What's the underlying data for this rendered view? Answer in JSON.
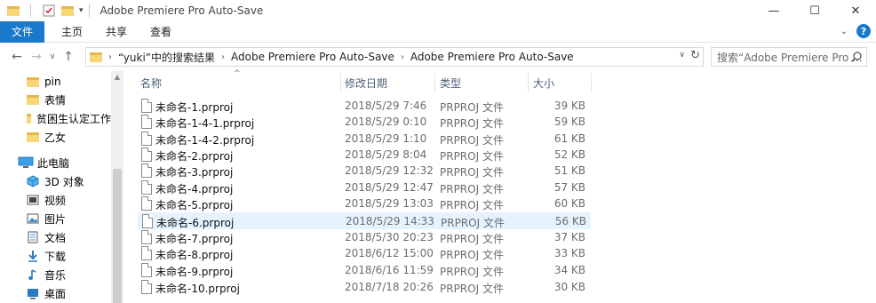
{
  "window": {
    "title": "Adobe Premiere Pro Auto-Save",
    "controls": {
      "minimize": "—",
      "maximize": "☐",
      "close": "✕"
    }
  },
  "ribbon": {
    "file_tab": "文件",
    "tabs": [
      "主页",
      "共享",
      "查看"
    ],
    "help": "?"
  },
  "address": {
    "crumbs": [
      "“yuki”中的搜索结果",
      "Adobe Premiere Pro Auto-Save",
      "Adobe Premiere Pro Auto-Save"
    ],
    "search_placeholder": "搜索“Adobe Premiere Pro ..."
  },
  "nav": {
    "folders": [
      "pin",
      "表情",
      "贫困生认定工作",
      "乙女"
    ],
    "this_pc": "此电脑",
    "pc_items": [
      "3D 对象",
      "视频",
      "图片",
      "文档",
      "下载",
      "音乐",
      "桌面"
    ]
  },
  "columns": {
    "name": "名称",
    "date": "修改日期",
    "type": "类型",
    "size": "大小"
  },
  "files": [
    {
      "name": "未命名-1.prproj",
      "date": "2018/5/29 7:46",
      "type": "PRPROJ 文件",
      "size": "39 KB"
    },
    {
      "name": "未命名-1-4-1.prproj",
      "date": "2018/5/29 0:10",
      "type": "PRPROJ 文件",
      "size": "59 KB"
    },
    {
      "name": "未命名-1-4-2.prproj",
      "date": "2018/5/29 1:10",
      "type": "PRPROJ 文件",
      "size": "61 KB"
    },
    {
      "name": "未命名-2.prproj",
      "date": "2018/5/29 8:04",
      "type": "PRPROJ 文件",
      "size": "52 KB"
    },
    {
      "name": "未命名-3.prproj",
      "date": "2018/5/29 12:32",
      "type": "PRPROJ 文件",
      "size": "51 KB"
    },
    {
      "name": "未命名-4.prproj",
      "date": "2018/5/29 12:47",
      "type": "PRPROJ 文件",
      "size": "57 KB"
    },
    {
      "name": "未命名-5.prproj",
      "date": "2018/5/29 13:03",
      "type": "PRPROJ 文件",
      "size": "60 KB"
    },
    {
      "name": "未命名-6.prproj",
      "date": "2018/5/29 14:33",
      "type": "PRPROJ 文件",
      "size": "56 KB"
    },
    {
      "name": "未命名-7.prproj",
      "date": "2018/5/30 20:23",
      "type": "PRPROJ 文件",
      "size": "37 KB"
    },
    {
      "name": "未命名-8.prproj",
      "date": "2018/6/12 15:00",
      "type": "PRPROJ 文件",
      "size": "33 KB"
    },
    {
      "name": "未命名-9.prproj",
      "date": "2018/6/16 11:59",
      "type": "PRPROJ 文件",
      "size": "34 KB"
    },
    {
      "name": "未命名-10.prproj",
      "date": "2018/7/18 20:26",
      "type": "PRPROJ 文件",
      "size": "30 KB"
    }
  ],
  "selected_file": "未命名-6.prproj",
  "colors": {
    "accent": "#1979ca",
    "selection": "#e5f3ff",
    "folder": "#f8d775"
  }
}
